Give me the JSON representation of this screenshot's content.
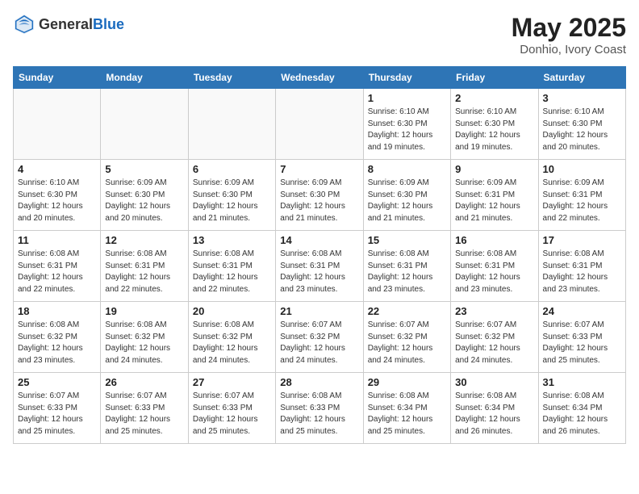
{
  "header": {
    "logo_general": "General",
    "logo_blue": "Blue",
    "month_year": "May 2025",
    "location": "Donhio, Ivory Coast"
  },
  "days_of_week": [
    "Sunday",
    "Monday",
    "Tuesday",
    "Wednesday",
    "Thursday",
    "Friday",
    "Saturday"
  ],
  "weeks": [
    [
      {
        "num": "",
        "info": ""
      },
      {
        "num": "",
        "info": ""
      },
      {
        "num": "",
        "info": ""
      },
      {
        "num": "",
        "info": ""
      },
      {
        "num": "1",
        "info": "Sunrise: 6:10 AM\nSunset: 6:30 PM\nDaylight: 12 hours\nand 19 minutes."
      },
      {
        "num": "2",
        "info": "Sunrise: 6:10 AM\nSunset: 6:30 PM\nDaylight: 12 hours\nand 19 minutes."
      },
      {
        "num": "3",
        "info": "Sunrise: 6:10 AM\nSunset: 6:30 PM\nDaylight: 12 hours\nand 20 minutes."
      }
    ],
    [
      {
        "num": "4",
        "info": "Sunrise: 6:10 AM\nSunset: 6:30 PM\nDaylight: 12 hours\nand 20 minutes."
      },
      {
        "num": "5",
        "info": "Sunrise: 6:09 AM\nSunset: 6:30 PM\nDaylight: 12 hours\nand 20 minutes."
      },
      {
        "num": "6",
        "info": "Sunrise: 6:09 AM\nSunset: 6:30 PM\nDaylight: 12 hours\nand 21 minutes."
      },
      {
        "num": "7",
        "info": "Sunrise: 6:09 AM\nSunset: 6:30 PM\nDaylight: 12 hours\nand 21 minutes."
      },
      {
        "num": "8",
        "info": "Sunrise: 6:09 AM\nSunset: 6:30 PM\nDaylight: 12 hours\nand 21 minutes."
      },
      {
        "num": "9",
        "info": "Sunrise: 6:09 AM\nSunset: 6:31 PM\nDaylight: 12 hours\nand 21 minutes."
      },
      {
        "num": "10",
        "info": "Sunrise: 6:09 AM\nSunset: 6:31 PM\nDaylight: 12 hours\nand 22 minutes."
      }
    ],
    [
      {
        "num": "11",
        "info": "Sunrise: 6:08 AM\nSunset: 6:31 PM\nDaylight: 12 hours\nand 22 minutes."
      },
      {
        "num": "12",
        "info": "Sunrise: 6:08 AM\nSunset: 6:31 PM\nDaylight: 12 hours\nand 22 minutes."
      },
      {
        "num": "13",
        "info": "Sunrise: 6:08 AM\nSunset: 6:31 PM\nDaylight: 12 hours\nand 22 minutes."
      },
      {
        "num": "14",
        "info": "Sunrise: 6:08 AM\nSunset: 6:31 PM\nDaylight: 12 hours\nand 23 minutes."
      },
      {
        "num": "15",
        "info": "Sunrise: 6:08 AM\nSunset: 6:31 PM\nDaylight: 12 hours\nand 23 minutes."
      },
      {
        "num": "16",
        "info": "Sunrise: 6:08 AM\nSunset: 6:31 PM\nDaylight: 12 hours\nand 23 minutes."
      },
      {
        "num": "17",
        "info": "Sunrise: 6:08 AM\nSunset: 6:31 PM\nDaylight: 12 hours\nand 23 minutes."
      }
    ],
    [
      {
        "num": "18",
        "info": "Sunrise: 6:08 AM\nSunset: 6:32 PM\nDaylight: 12 hours\nand 23 minutes."
      },
      {
        "num": "19",
        "info": "Sunrise: 6:08 AM\nSunset: 6:32 PM\nDaylight: 12 hours\nand 24 minutes."
      },
      {
        "num": "20",
        "info": "Sunrise: 6:08 AM\nSunset: 6:32 PM\nDaylight: 12 hours\nand 24 minutes."
      },
      {
        "num": "21",
        "info": "Sunrise: 6:07 AM\nSunset: 6:32 PM\nDaylight: 12 hours\nand 24 minutes."
      },
      {
        "num": "22",
        "info": "Sunrise: 6:07 AM\nSunset: 6:32 PM\nDaylight: 12 hours\nand 24 minutes."
      },
      {
        "num": "23",
        "info": "Sunrise: 6:07 AM\nSunset: 6:32 PM\nDaylight: 12 hours\nand 24 minutes."
      },
      {
        "num": "24",
        "info": "Sunrise: 6:07 AM\nSunset: 6:33 PM\nDaylight: 12 hours\nand 25 minutes."
      }
    ],
    [
      {
        "num": "25",
        "info": "Sunrise: 6:07 AM\nSunset: 6:33 PM\nDaylight: 12 hours\nand 25 minutes."
      },
      {
        "num": "26",
        "info": "Sunrise: 6:07 AM\nSunset: 6:33 PM\nDaylight: 12 hours\nand 25 minutes."
      },
      {
        "num": "27",
        "info": "Sunrise: 6:07 AM\nSunset: 6:33 PM\nDaylight: 12 hours\nand 25 minutes."
      },
      {
        "num": "28",
        "info": "Sunrise: 6:08 AM\nSunset: 6:33 PM\nDaylight: 12 hours\nand 25 minutes."
      },
      {
        "num": "29",
        "info": "Sunrise: 6:08 AM\nSunset: 6:34 PM\nDaylight: 12 hours\nand 25 minutes."
      },
      {
        "num": "30",
        "info": "Sunrise: 6:08 AM\nSunset: 6:34 PM\nDaylight: 12 hours\nand 26 minutes."
      },
      {
        "num": "31",
        "info": "Sunrise: 6:08 AM\nSunset: 6:34 PM\nDaylight: 12 hours\nand 26 minutes."
      }
    ]
  ]
}
